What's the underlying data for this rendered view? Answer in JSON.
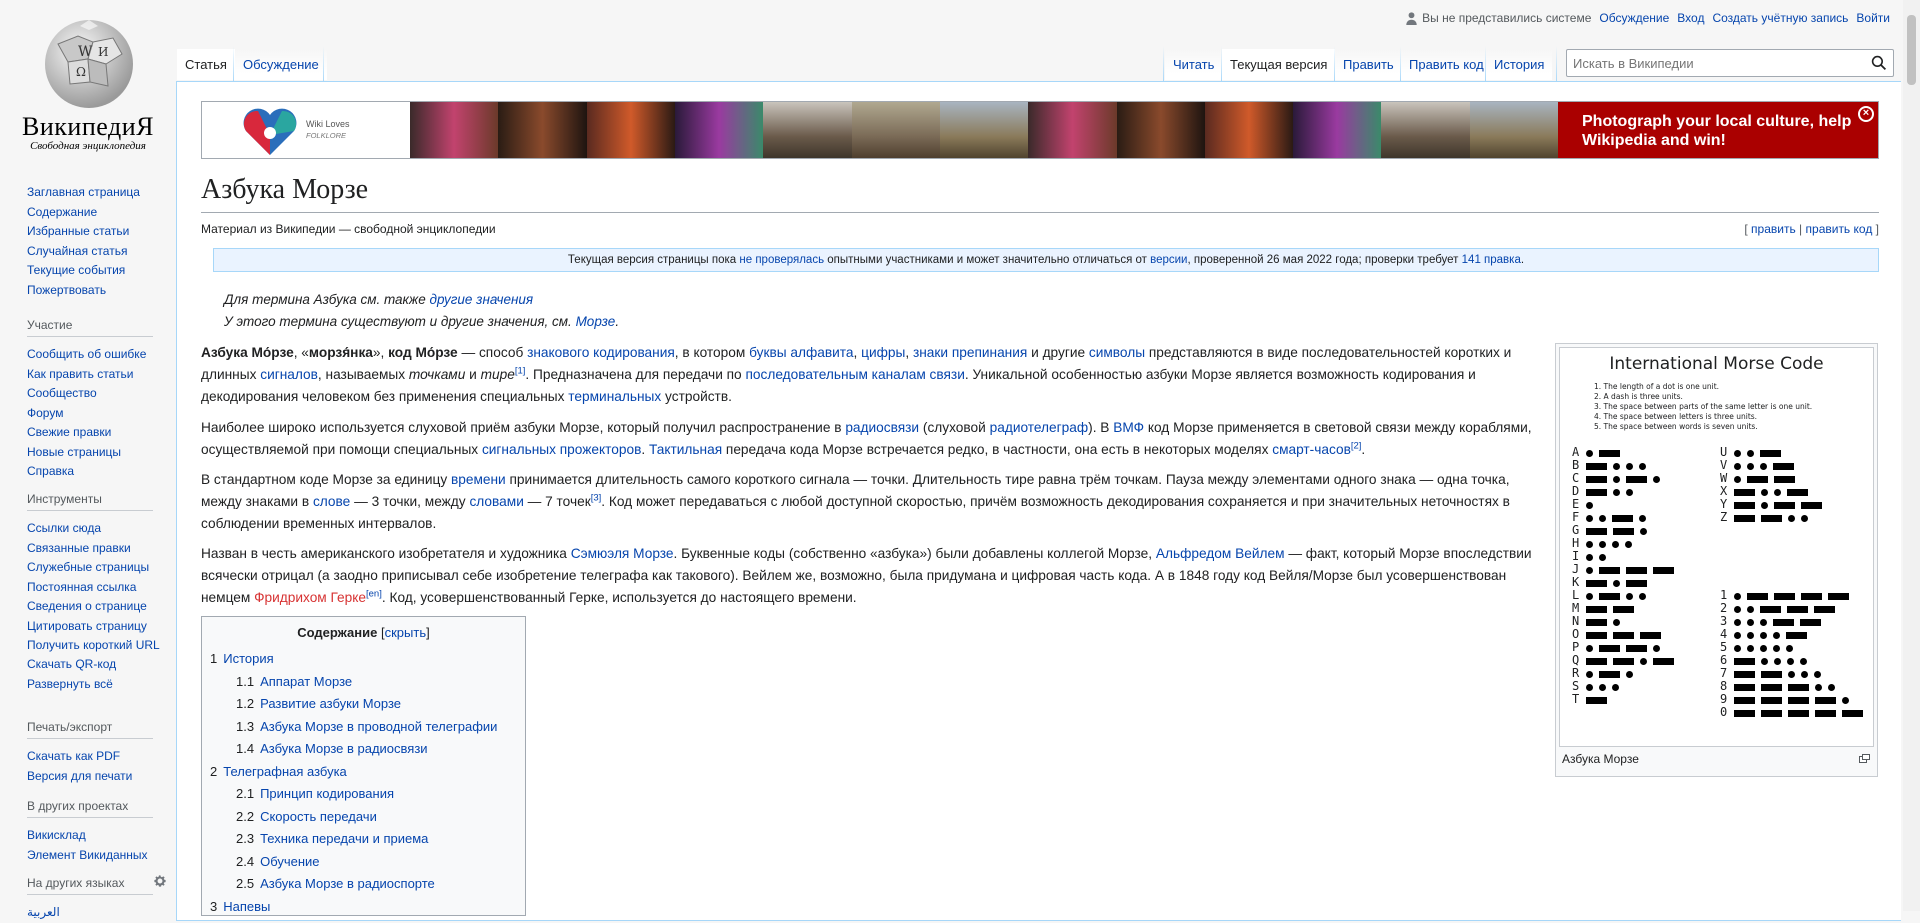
{
  "logo": {
    "wordmark": "ВикипедиЯ",
    "tagline": "Свободная энциклопедия"
  },
  "sidebar": {
    "navigation": [
      "Заглавная страница",
      "Содержание",
      "Избранные статьи",
      "Случайная статья",
      "Текущие события",
      "Пожертвовать"
    ],
    "participation": {
      "heading": "Участие",
      "items": [
        "Сообщить об ошибке",
        "Как править статьи",
        "Сообщество",
        "Форум",
        "Свежие правки",
        "Новые страницы",
        "Справка"
      ]
    },
    "tools": {
      "heading": "Инструменты",
      "items": [
        "Ссылки сюда",
        "Связанные правки",
        "Служебные страницы",
        "Постоянная ссылка",
        "Сведения о странице",
        "Цитировать страницу",
        "Получить короткий URL",
        "Скачать QR-код",
        "Развернуть всё"
      ]
    },
    "print": {
      "heading": "Печать/экспорт",
      "items": [
        "Скачать как PDF",
        "Версия для печати"
      ]
    },
    "projects": {
      "heading": "В других проектах",
      "items": [
        "Викисклад",
        "Элемент Викиданных"
      ]
    },
    "languages": {
      "heading": "На других языках",
      "first": "العربية"
    }
  },
  "personal": {
    "not_logged": "Вы не представились системе",
    "talk": "Обсуждение",
    "login": "Вход",
    "create": "Создать учётную запись",
    "logout": "Войти"
  },
  "tabs": {
    "article": "Статья",
    "discussion": "Обсуждение",
    "read": "Читать",
    "current": "Текущая версия",
    "edit": "Править",
    "edit_code": "Править код",
    "history": "История"
  },
  "search": {
    "placeholder": "Искать в Википедии"
  },
  "banner": {
    "logo_line1": "Wiki Loves",
    "logo_line2": "FOLKLORE",
    "cta": "Photograph your local culture, help Wikipedia and win!"
  },
  "article": {
    "title": "Азбука Морзе",
    "sitesub": "Материал из Википедии — свободной энциклопедии",
    "edit_links": {
      "edit": "править",
      "edit_code": "править код"
    },
    "flagged": {
      "before": "Текущая версия страницы пока ",
      "link1": "не проверялась",
      "mid": " опытными участниками и может значительно отличаться от ",
      "link2": "версии",
      "after": ", проверенной 26 мая 2022 года; проверки требует ",
      "link3": "141 правка",
      "end": "."
    },
    "hatnote1": {
      "text": "Для термина Азбука см. также ",
      "link": "другие значения"
    },
    "hatnote2": {
      "text": "У этого термина существуют и другие значения, см. ",
      "link": "Морзе",
      "end": "."
    }
  },
  "toc": {
    "title": "Содержание",
    "toggle": "скрыть",
    "items": [
      {
        "num": "1",
        "text": "История",
        "level": 1
      },
      {
        "num": "1.1",
        "text": "Аппарат Морзе",
        "level": 2
      },
      {
        "num": "1.2",
        "text": "Развитие азбуки Морзе",
        "level": 2
      },
      {
        "num": "1.3",
        "text": "Азбука Морзе в проводной телеграфии",
        "level": 2
      },
      {
        "num": "1.4",
        "text": "Азбука Морзе в радиосвязи",
        "level": 2
      },
      {
        "num": "2",
        "text": "Телеграфная азбука",
        "level": 1
      },
      {
        "num": "2.1",
        "text": "Принцип кодирования",
        "level": 2
      },
      {
        "num": "2.2",
        "text": "Скорость передачи",
        "level": 2
      },
      {
        "num": "2.3",
        "text": "Техника передачи и приема",
        "level": 2
      },
      {
        "num": "2.4",
        "text": "Обучение",
        "level": 2
      },
      {
        "num": "2.5",
        "text": "Азбука Морзе в радиоспорте",
        "level": 2
      },
      {
        "num": "3",
        "text": "Напевы",
        "level": 1
      }
    ]
  },
  "thumb": {
    "title": "International Morse Code",
    "rules": [
      "1. The length of a dot is one unit.",
      "2. A dash is three units.",
      "3. The space between parts of the same letter is one unit.",
      "4. The space between letters is three units.",
      "5. The space between words is seven units."
    ],
    "caption": "Азбука Морзе",
    "left": [
      [
        "A",
        ".-"
      ],
      [
        "B",
        "-..."
      ],
      [
        "C",
        "-.-."
      ],
      [
        "D",
        "-.."
      ],
      [
        "E",
        "."
      ],
      [
        "F",
        "..-."
      ],
      [
        "G",
        "--."
      ],
      [
        "H",
        "...."
      ],
      [
        "I",
        ".."
      ],
      [
        "J",
        ".---"
      ],
      [
        "K",
        "-.-"
      ],
      [
        "L",
        ".-.."
      ],
      [
        "M",
        "--"
      ],
      [
        "N",
        "-."
      ],
      [
        "O",
        "---"
      ],
      [
        "P",
        ".--."
      ],
      [
        "Q",
        "--.-"
      ],
      [
        "R",
        ".-."
      ],
      [
        "S",
        "..."
      ],
      [
        "T",
        "-"
      ]
    ],
    "right_top": [
      [
        "U",
        "..-"
      ],
      [
        "V",
        "...-"
      ],
      [
        "W",
        ".--"
      ],
      [
        "X",
        "-..-"
      ],
      [
        "Y",
        "-.--"
      ],
      [
        "Z",
        "--.."
      ]
    ],
    "right_bottom": [
      [
        "1",
        ".----"
      ],
      [
        "2",
        "..---"
      ],
      [
        "3",
        "...--"
      ],
      [
        "4",
        "....-"
      ],
      [
        "5",
        "....."
      ],
      [
        "6",
        "-...."
      ],
      [
        "7",
        "--..."
      ],
      [
        "8",
        "---.."
      ],
      [
        "9",
        "----."
      ],
      [
        "0",
        "-----"
      ]
    ]
  },
  "colors": {
    "link": "#0645ad",
    "redlink": "#d73333",
    "banner_red": "#aa0000"
  }
}
